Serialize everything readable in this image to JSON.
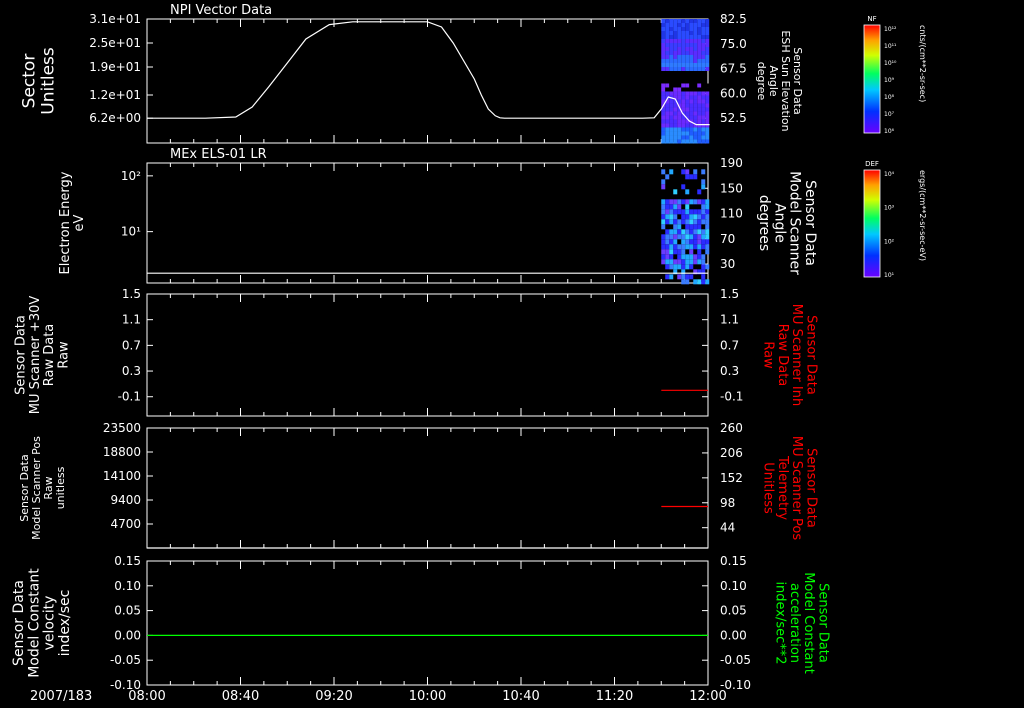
{
  "colors": {
    "background": "#000000",
    "frame": "#ffffff",
    "red": "#ff0000",
    "green": "#00ff00"
  },
  "chart_data": [
    {
      "type": "line",
      "title": "NPI Vector Data",
      "ylabel_left": [
        "Sector",
        "Unitless"
      ],
      "left_ticks": [
        "3.1e+01",
        "2.5e+01",
        "1.9e+01",
        "1.2e+01",
        "6.2e+00"
      ],
      "ylim_left": [
        0,
        31
      ],
      "ylabel_right": [
        "Sensor Data",
        "ESH Sun Elevation",
        "Angle",
        "degree"
      ],
      "right_ticks": [
        "82.5",
        "75.0",
        "67.5",
        "60.0",
        "52.5"
      ],
      "ylim_right": [
        45,
        82.5
      ],
      "series": [
        {
          "x": [
            480,
            505,
            518,
            525,
            532,
            540,
            548,
            558,
            568,
            580,
            595,
            600,
            606,
            611,
            620,
            623,
            626,
            629,
            631,
            633,
            639,
            645,
            650,
            660,
            670,
            680,
            692,
            697,
            700,
            703,
            706,
            709,
            712,
            715,
            720,
            720.7
          ],
          "y": [
            6.2,
            6.2,
            6.5,
            9,
            14,
            20,
            26,
            29.6,
            30.3,
            30.3,
            30.3,
            30.3,
            29,
            25,
            16,
            12,
            8.5,
            6.8,
            6.3,
            6.2,
            6.2,
            6.2,
            6.2,
            6.2,
            6.2,
            6.2,
            6.2,
            6.3,
            8.5,
            11.5,
            11,
            7.5,
            5.5,
            4.6,
            4.6,
            4.6
          ]
        }
      ],
      "spectrogram": {
        "x_start": 700,
        "x_end": 720,
        "bands": [
          {
            "y_from": 82.5,
            "y_to": 67.0
          },
          {
            "y_from": 63.0,
            "y_to": 45.0
          }
        ]
      },
      "colorbar": {
        "label": "NF",
        "units": "cnts/(cm**2-sr-sec)",
        "ticks": [
          "10¹²",
          "10¹¹",
          "10¹⁰",
          "10⁹",
          "10⁸",
          "10⁷",
          "10⁶"
        ]
      }
    },
    {
      "type": "line",
      "title": "MEx ELS-01 LR",
      "ylabel_left": [
        "Electron Energy",
        "eV"
      ],
      "left_ticks": [
        "10²",
        "10¹"
      ],
      "ylim_left": [
        1.2,
        170
      ],
      "ylog": true,
      "ylabel_right": [
        "Sensor Data",
        "Model Scanner",
        "Angle",
        "degrees"
      ],
      "right_ticks": [
        "190",
        "150",
        "110",
        "70",
        "30"
      ],
      "ylim_right": [
        0,
        190
      ],
      "series": [
        {
          "x": [
            480,
            720
          ],
          "y": [
            1.8,
            1.8
          ]
        }
      ],
      "spectrogram": {
        "x_start": 700,
        "x_end": 720,
        "y_from": 180,
        "y_to": 0
      },
      "colorbar": {
        "label": "DEF",
        "units": "ergs/(cm**2-sr-sec-eV)",
        "ticks": [
          "10⁴",
          "10³",
          "10²",
          "10¹"
        ]
      }
    },
    {
      "type": "line",
      "title": "",
      "ylabel_left": [
        "Sensor Data",
        "MU Scanner +30V",
        "Raw Data",
        "Raw"
      ],
      "left_ticks": [
        "1.5",
        "1.1",
        "0.7",
        "0.3",
        "-0.1"
      ],
      "ylim_left": [
        -0.4,
        1.5
      ],
      "ylabel_right": [
        "Sensor Data",
        "MU Scanner Inh",
        "Raw Data",
        "Raw"
      ],
      "right_ticks": [
        "1.5",
        "1.1",
        "0.7",
        "0.3",
        "-0.1"
      ],
      "ylim_right": [
        -0.4,
        1.5
      ],
      "series": [
        {
          "name": "Sensor Data MU Scanner Inh Raw Data",
          "axis": "right",
          "x": [
            700,
            720
          ],
          "y": [
            0,
            0
          ]
        }
      ]
    },
    {
      "type": "line",
      "title": "",
      "ylabel_left": [
        "Sensor Data",
        "Model Scanner Pos",
        "Raw",
        "unitless"
      ],
      "left_ticks": [
        "23500",
        "18800",
        "14100",
        "9400",
        "4700"
      ],
      "ylim_left": [
        0,
        23500
      ],
      "ylabel_right": [
        "Sensor Data",
        "MU Scanner Pos",
        "Telemetry",
        "Unitless"
      ],
      "right_ticks": [
        "260",
        "206",
        "152",
        "98",
        "44"
      ],
      "ylim_right": [
        0,
        260
      ],
      "series": [
        {
          "name": "Sensor Data MU Scanner Pos Telemetry",
          "axis": "right",
          "x": [
            700,
            720
          ],
          "y": [
            90,
            90
          ]
        },
        {
          "axis": "left",
          "x": [
            480,
            720
          ],
          "y": [
            0,
            0
          ]
        }
      ]
    },
    {
      "type": "line",
      "title": "",
      "ylabel_left": [
        "Sensor Data",
        "Model Constant",
        "velocity",
        "index/sec"
      ],
      "left_ticks": [
        "0.15",
        "0.10",
        "0.05",
        "0.00",
        "-0.05",
        "-0.10"
      ],
      "ylim_left": [
        -0.1,
        0.15
      ],
      "ylabel_right": [
        "Sensor Data",
        "Model Constant",
        "acceleration",
        "index/sec**2"
      ],
      "right_ticks": [
        "0.15",
        "0.10",
        "0.05",
        "0.00",
        "-0.05",
        "-0.10"
      ],
      "ylim_right": [
        -0.1,
        0.15
      ],
      "series": [
        {
          "name": "Sensor Data Model Constant acceleration",
          "axis": "right",
          "x": [
            480,
            720
          ],
          "y": [
            0,
            0
          ]
        }
      ]
    }
  ],
  "time_axis": {
    "date_label": "2007/183",
    "tick_labels": [
      "08:00",
      "08:40",
      "09:20",
      "10:00",
      "10:40",
      "11:20",
      "12:00"
    ],
    "xlim": [
      480,
      720
    ],
    "minor_step": 10
  }
}
